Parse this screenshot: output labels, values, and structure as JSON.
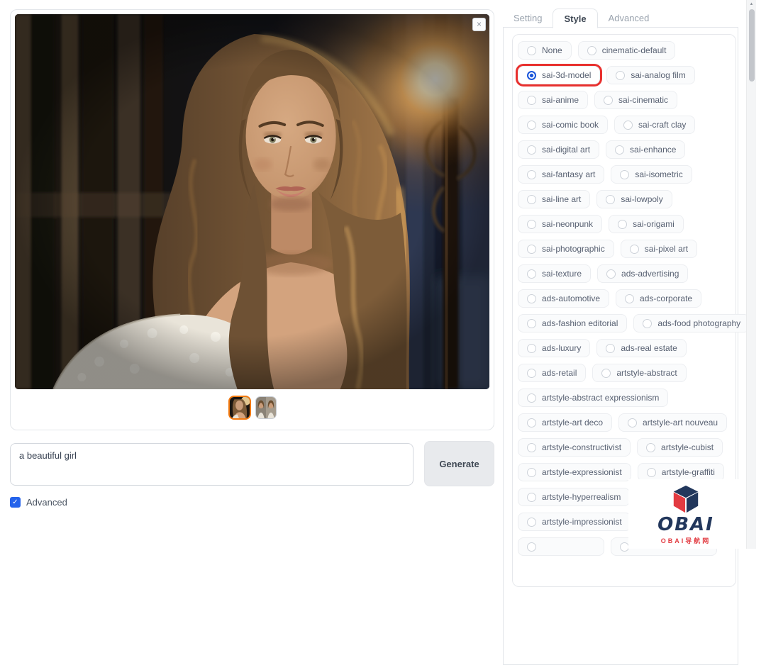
{
  "tabs": [
    {
      "label": "Setting",
      "active": false
    },
    {
      "label": "Style",
      "active": true
    },
    {
      "label": "Advanced",
      "active": false
    }
  ],
  "style_panel": {
    "selected": "sai-3d-model",
    "selected_highlight_color": "#e8302e",
    "radio_selected_color": "#2563eb",
    "rows": [
      [
        "None",
        "cinematic-default"
      ],
      [
        "sai-3d-model",
        "sai-analog film"
      ],
      [
        "sai-anime",
        "sai-cinematic"
      ],
      [
        "sai-comic book",
        "sai-craft clay"
      ],
      [
        "sai-digital art",
        "sai-enhance"
      ],
      [
        "sai-fantasy art",
        "sai-isometric"
      ],
      [
        "sai-line art",
        "sai-lowpoly"
      ],
      [
        "sai-neonpunk",
        "sai-origami"
      ],
      [
        "sai-photographic",
        "sai-pixel art"
      ],
      [
        "sai-texture",
        "ads-advertising"
      ],
      [
        "ads-automotive",
        "ads-corporate"
      ],
      [
        "ads-fashion editorial",
        "ads-food photography"
      ],
      [
        "ads-luxury",
        "ads-real estate"
      ],
      [
        "ads-retail",
        "artstyle-abstract"
      ],
      [
        "artstyle-abstract expressionism"
      ],
      [
        "artstyle-art deco",
        "artstyle-art nouveau"
      ],
      [
        "artstyle-constructivist",
        "artstyle-cubist"
      ],
      [
        "artstyle-expressionist",
        "artstyle-graffiti"
      ],
      [
        "artstyle-hyperrealism"
      ],
      [
        "artstyle-impressionist"
      ],
      [
        "",
        ""
      ]
    ]
  },
  "preview": {
    "close_icon": "×",
    "thumbnails": [
      {
        "selected": true
      },
      {
        "selected": false
      }
    ]
  },
  "prompt": {
    "value": "a beautiful girl",
    "generate_label": "Generate"
  },
  "advanced": {
    "label": "Advanced",
    "checked": true,
    "check_icon": "✓"
  },
  "scrollbar": {
    "up_arrow_icon": "▲"
  },
  "logo": {
    "text": "OBAI",
    "subtext": "OBAI导航网",
    "navy": "#22375c",
    "red": "#e23b41"
  }
}
